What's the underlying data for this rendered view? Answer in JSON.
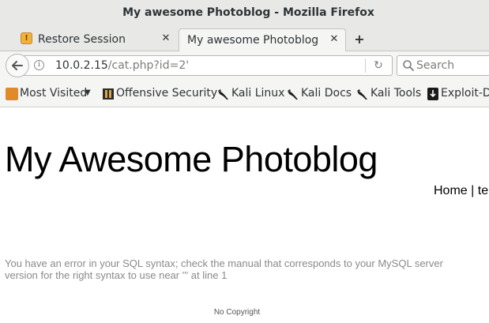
{
  "window": {
    "title": "My awesome Photoblog - Mozilla Firefox"
  },
  "tabs": [
    {
      "label": "Restore Session",
      "icon": "restore-session-icon",
      "active": false
    },
    {
      "label": "My awesome Photoblog",
      "active": true
    }
  ],
  "navbar": {
    "url_host": "10.0.2.15",
    "url_path": "/cat.php?id=2'",
    "search_placeholder": "Search"
  },
  "bookmarks": [
    {
      "label": "Most Visited",
      "icon": "folder-icon",
      "has_dropdown": true
    },
    {
      "label": "Offensive Security",
      "icon": "offsec-icon"
    },
    {
      "label": "Kali Linux",
      "icon": "kali-dragon-icon"
    },
    {
      "label": "Kali Docs",
      "icon": "kali-dragon-icon"
    },
    {
      "label": "Kali Tools",
      "icon": "kali-dragon-icon"
    },
    {
      "label": "Exploit-DB",
      "icon": "exploit-db-icon"
    }
  ],
  "page": {
    "site_title": "My Awesome Photoblog",
    "nav_home": "Home",
    "nav_separator": "|",
    "nav_next": "te",
    "error_message": "You have an error in your SQL syntax; check the manual that corresponds to your MySQL server version for the right syntax to use near ''' at line 1",
    "footer": "No Copyright"
  },
  "colors": {
    "chrome_bg": "#e8e8e7",
    "toolbar_bg": "#f5f5f4",
    "error_text": "#8a8a8a"
  }
}
